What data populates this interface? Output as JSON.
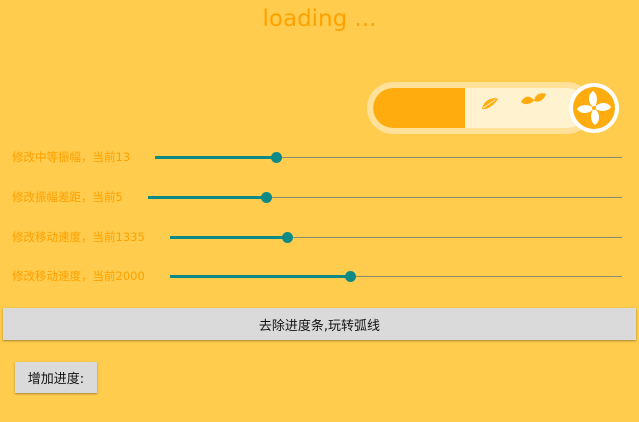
{
  "header": {
    "title": "loading ..."
  },
  "progress": {
    "fraction": 0.43,
    "colors": {
      "fill": "#FFAC0E",
      "track": "#FFF3CF",
      "ring": "#FFE19A",
      "fan": "#FFAC0E"
    },
    "icons": [
      "leaf-icon",
      "fan-icon"
    ]
  },
  "sliders": [
    {
      "label": "修改中等振幅，当前13",
      "value": 0.26
    },
    {
      "label": "修改振幅差距，当前5",
      "value": 0.25
    },
    {
      "label": "修改移动速度，当前1335",
      "value": 0.26
    },
    {
      "label": "修改移动速度，当前2000",
      "value": 0.4
    }
  ],
  "actions": {
    "toggle_label": "去除进度条,玩转弧线",
    "add_label": "增加进度:"
  },
  "colors": {
    "background": "#FFCC4D",
    "accent": "#FFA200",
    "slider": "#0E8A86"
  }
}
